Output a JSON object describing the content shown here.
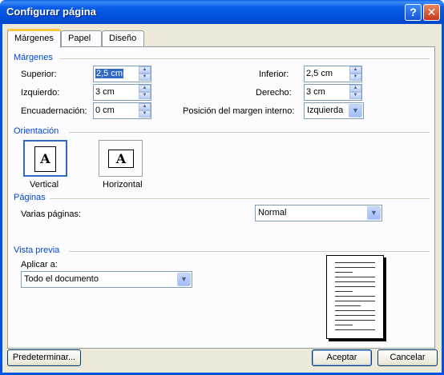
{
  "window": {
    "title": "Configurar página",
    "help_label": "?",
    "close_label": "✕"
  },
  "tabs": [
    {
      "label": "Márgenes",
      "active": true
    },
    {
      "label": "Papel",
      "active": false
    },
    {
      "label": "Diseño",
      "active": false
    }
  ],
  "margins": {
    "group_label": "Márgenes",
    "superior": {
      "label": "Superior:",
      "value": "2,5 cm"
    },
    "inferior": {
      "label": "Inferior:",
      "value": "2,5 cm"
    },
    "izquierdo": {
      "label": "Izquierdo:",
      "value": "3 cm"
    },
    "derecho": {
      "label": "Derecho:",
      "value": "3 cm"
    },
    "encuadernacion": {
      "label": "Encuadernación:",
      "value": "0 cm"
    },
    "posicion": {
      "label": "Posición del margen interno:",
      "value": "Izquierda"
    }
  },
  "orientation": {
    "group_label": "Orientación",
    "vertical_label": "Vertical",
    "horizontal_label": "Horizontal",
    "glyph": "A",
    "selected": "vertical"
  },
  "pages": {
    "group_label": "Páginas",
    "multiple_label": "Varias páginas:",
    "multiple_value": "Normal"
  },
  "preview": {
    "group_label": "Vista previa",
    "apply_label": "Aplicar a:",
    "apply_value": "Todo el documento"
  },
  "buttons": {
    "default_label": "Predeterminar...",
    "ok_label": "Aceptar",
    "cancel_label": "Cancelar"
  },
  "colors": {
    "titlebar": "#0054e3",
    "accent_text": "#0046d5",
    "selection": "#316ac5",
    "dialog_bg": "#ece9d8"
  }
}
